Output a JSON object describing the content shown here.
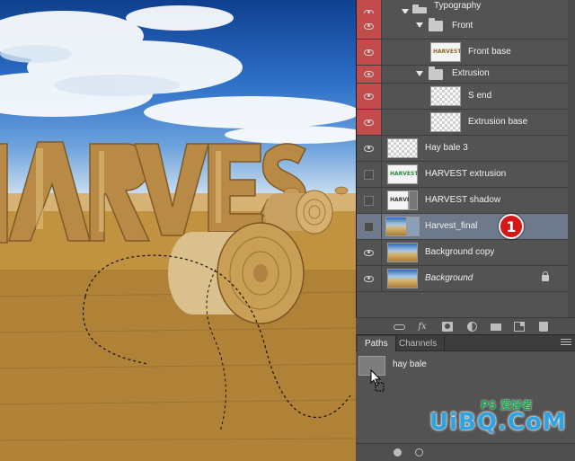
{
  "canvas": {
    "image_text": "HARVEST"
  },
  "layers": [
    {
      "name": "Typography",
      "kind": "group",
      "visible": true,
      "highlight": "red",
      "expanded": true
    },
    {
      "name": "Front",
      "kind": "group",
      "visible": true,
      "highlight": "red",
      "expanded": true
    },
    {
      "name": "Front base",
      "kind": "layer",
      "visible": true,
      "highlight": "red",
      "thumb": "HARVEST"
    },
    {
      "name": "Extrusion",
      "kind": "group",
      "visible": true,
      "highlight": "red",
      "expanded": true
    },
    {
      "name": "S end",
      "kind": "layer",
      "visible": true,
      "highlight": "red"
    },
    {
      "name": "Extrusion base",
      "kind": "layer",
      "visible": true,
      "highlight": "red"
    },
    {
      "name": "Hay bale 3",
      "kind": "layer",
      "visible": true
    },
    {
      "name": "HARVEST extrusion",
      "kind": "layer",
      "visible": false,
      "thumb": "HARVEST"
    },
    {
      "name": "HARVEST shadow",
      "kind": "layer",
      "visible": false,
      "thumb": "HARVEST"
    },
    {
      "name": "Harvest_final",
      "kind": "layer",
      "visible": false,
      "selected": true
    },
    {
      "name": "Background copy",
      "kind": "layer",
      "visible": true
    },
    {
      "name": "Background",
      "kind": "layer",
      "visible": true,
      "italic": true,
      "locked": true
    }
  ],
  "callout": "1",
  "paths_panel": {
    "tabs": [
      "Paths",
      "Channels"
    ],
    "active_tab": "Paths",
    "paths": [
      {
        "name": "hay bale"
      }
    ]
  },
  "watermark": {
    "text": "UiBQ.CoM",
    "small": "PS 爱好者"
  },
  "colors": {
    "panel": "#535353",
    "highlight_red": "#c24b4b",
    "selected": "#6e7a8c",
    "callout": "#d41818",
    "watermark": "#2ea3e0"
  }
}
